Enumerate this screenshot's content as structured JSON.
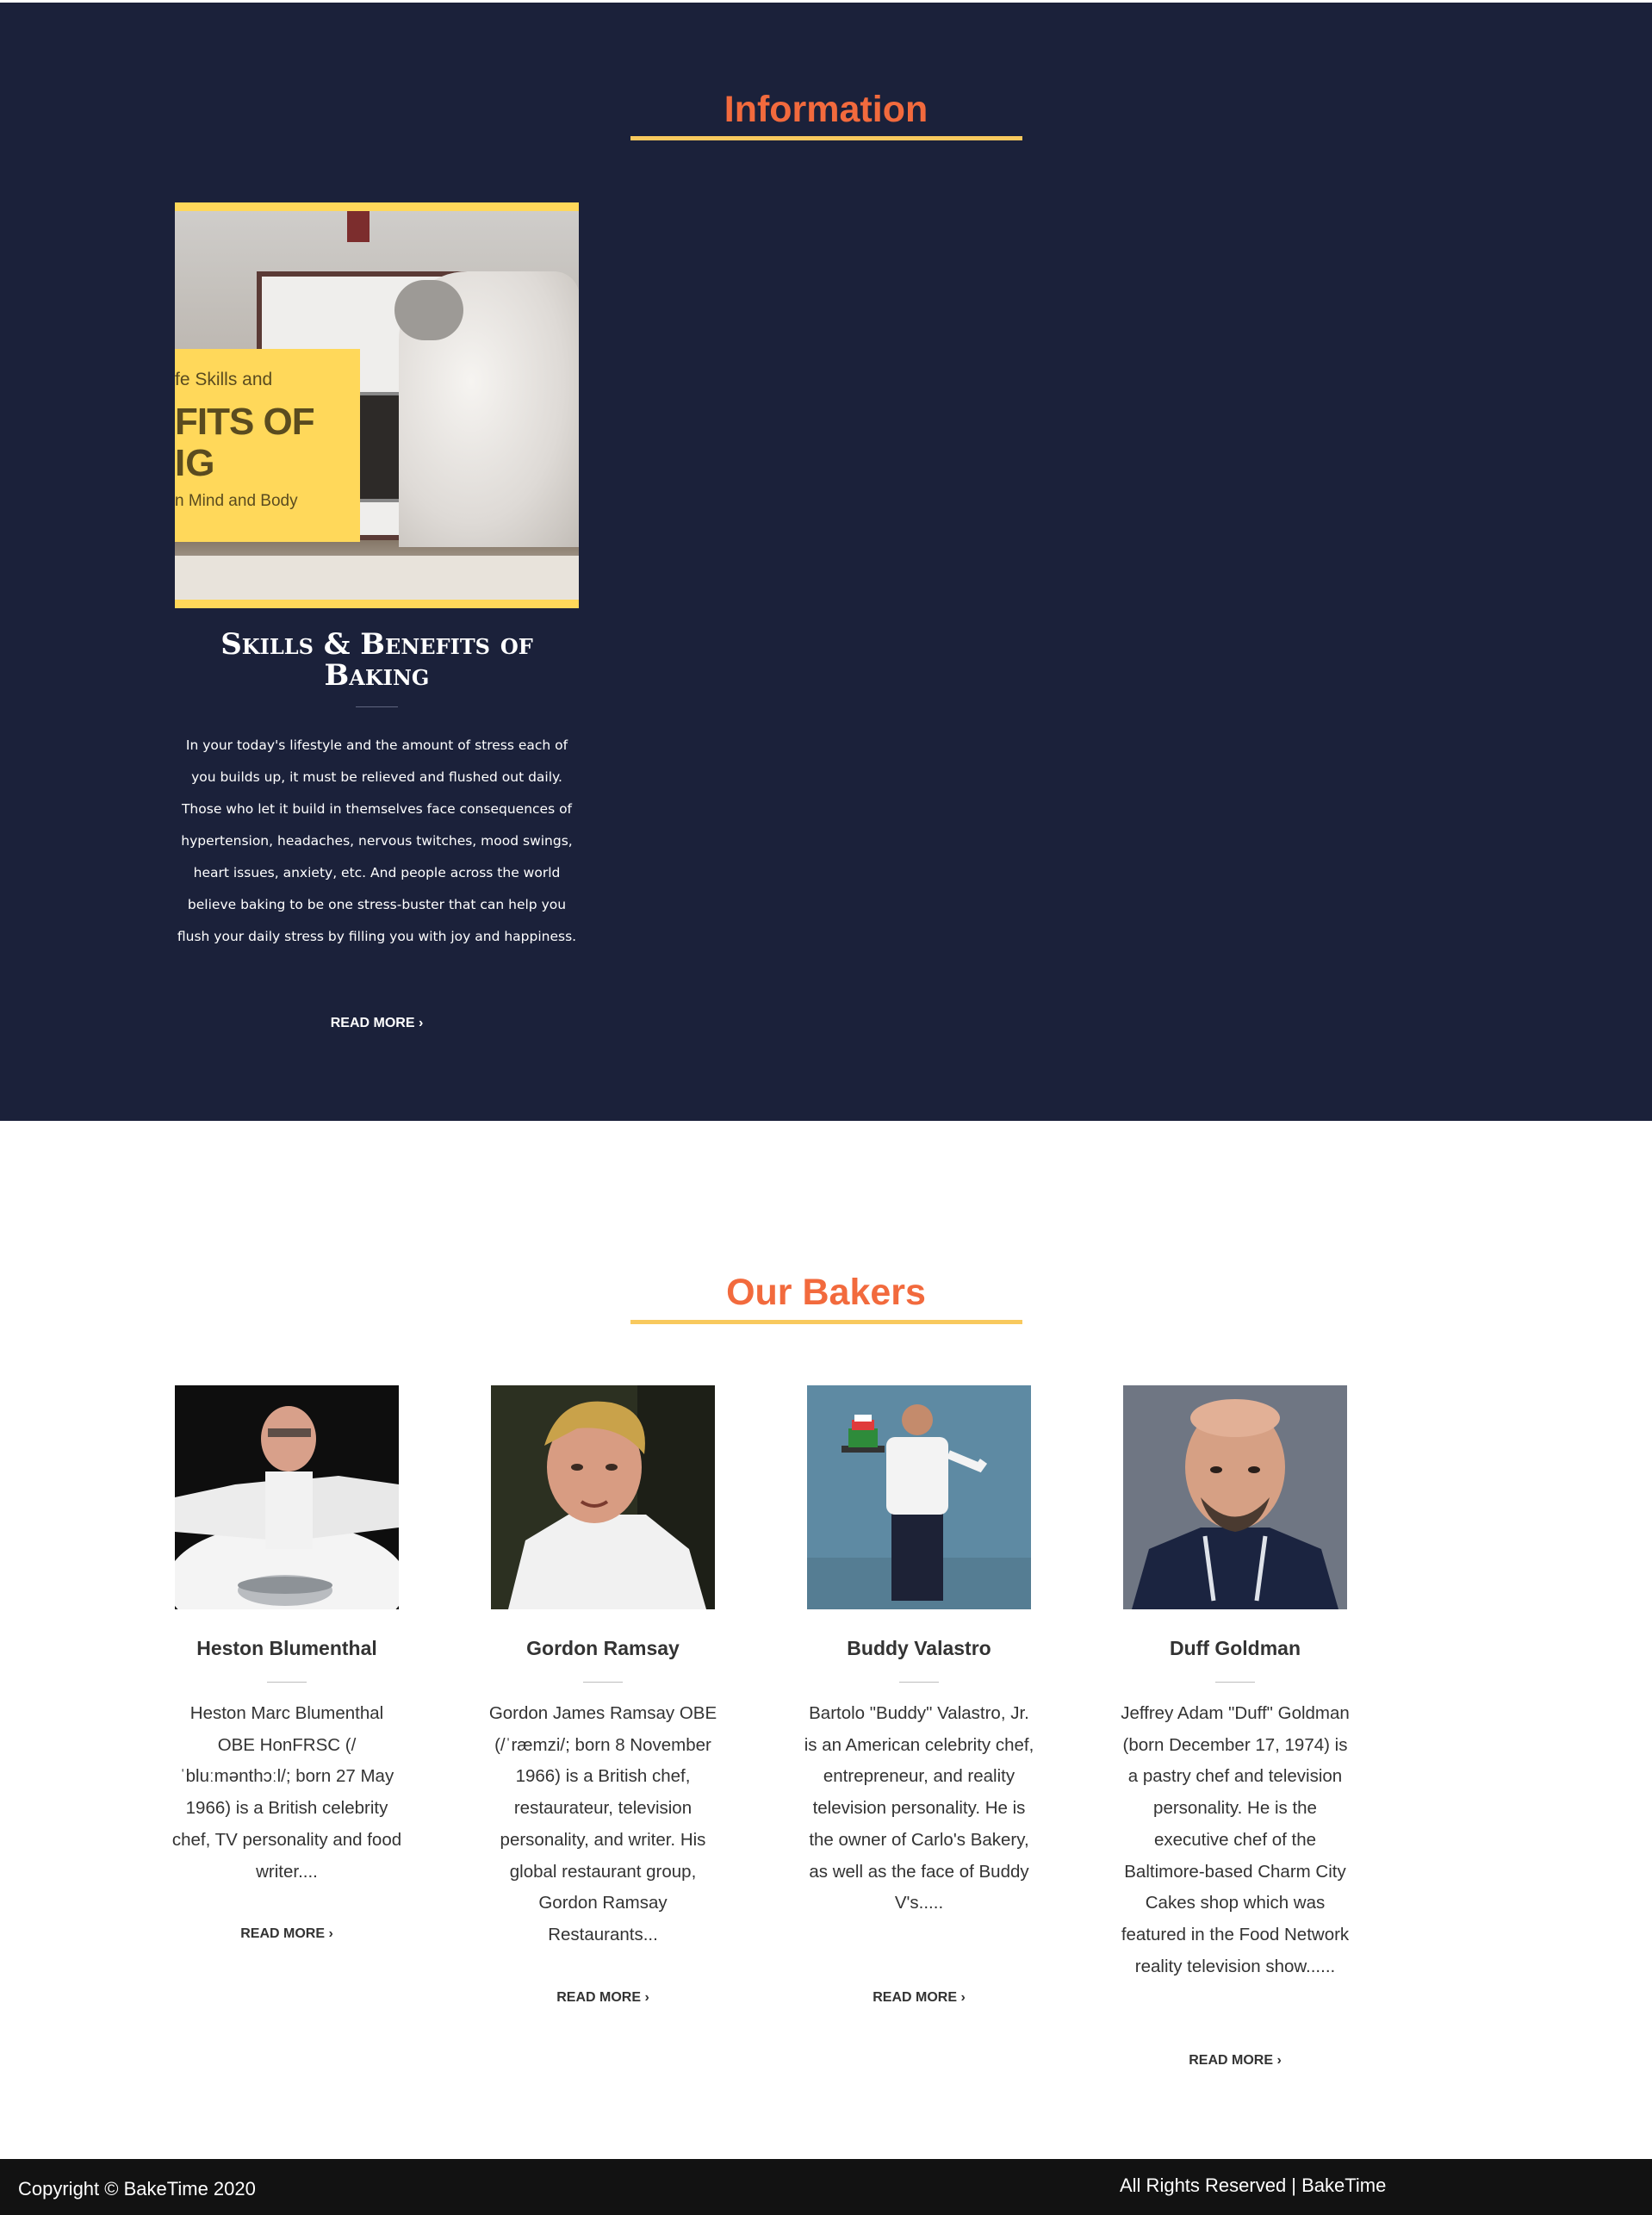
{
  "information": {
    "title": "Information",
    "card": {
      "image_banner": {
        "line1": "fe Skills and",
        "line2": "FITS OF",
        "line3": "IG",
        "line4": "n Mind and Body"
      },
      "title": "Skills & Benefits of Baking",
      "text": "In your today's lifestyle and the amount of stress each of you builds up, it must be relieved and flushed out daily. Those who let it build in themselves face consequences of hypertension, headaches, nervous twitches, mood swings, heart issues, anxiety, etc. And people across the world believe baking to be one stress-buster that can help you flush your daily stress by filling you with joy and happiness.",
      "read_more": "READ MORE  ›"
    }
  },
  "bakers": {
    "title": "Our Bakers",
    "items": [
      {
        "name": "Heston Blumenthal",
        "bio": "Heston Marc Blumenthal OBE HonFRSC (/ˈbluːmənthɔːl/; born 27 May 1966) is a British celebrity chef, TV personality and food writer....",
        "read_more": "READ MORE  ›"
      },
      {
        "name": "Gordon Ramsay",
        "bio": "Gordon James Ramsay OBE (/ˈræmzi/; born 8 November 1966) is a British chef, restaurateur, television personality, and writer. His global restaurant group, Gordon Ramsay Restaurants...",
        "read_more": "READ MORE  ›"
      },
      {
        "name": "Buddy Valastro",
        "bio": "Bartolo \"Buddy\" Valastro, Jr. is an American celebrity chef, entrepreneur, and reality television personality. He is the owner of Carlo's Bakery, as well as the face of Buddy V's.....",
        "read_more": "READ MORE  ›"
      },
      {
        "name": "Duff Goldman",
        "bio": "Jeffrey Adam \"Duff\" Goldman (born December 17, 1974) is a pastry chef and television personality. He is the executive chef of the Baltimore-based Charm City Cakes shop which was featured in the Food Network reality television show......",
        "read_more": "READ MORE  ›"
      }
    ]
  },
  "footer": {
    "copyright": "Copyright © BakeTime 2020",
    "rights": "All Rights Reserved | BakeTime"
  },
  "colors": {
    "info_background": "#1b213a",
    "title_accent": "#f26a3d",
    "underline_accent": "#f8c95e",
    "footer_background": "#121212"
  }
}
